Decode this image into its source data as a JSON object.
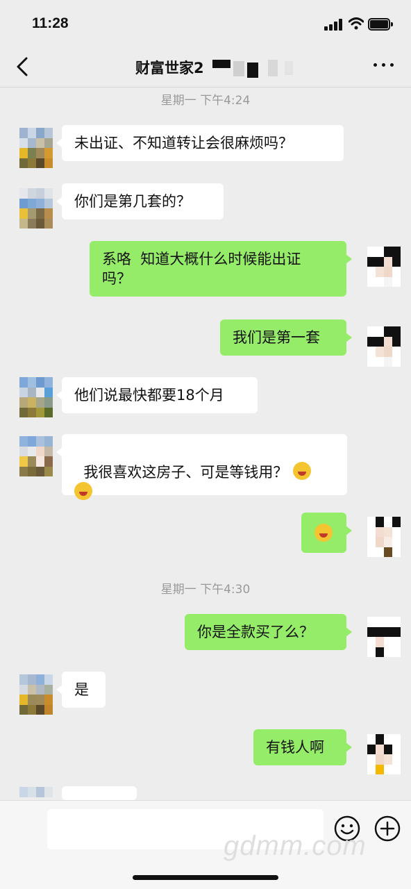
{
  "status": {
    "time": "11:28"
  },
  "header": {
    "title": "财富世家2"
  },
  "timestamps": [
    "星期一 下午4:24",
    "星期一 下午4:30"
  ],
  "messages": [
    {
      "from": "other",
      "text": "未出证、不知道转让会很麻烦吗？"
    },
    {
      "from": "other",
      "text": "你们是第几套的？"
    },
    {
      "from": "self",
      "text": "系咯  知道大概什么时候能出证\n吗？"
    },
    {
      "from": "self",
      "text": "我们是第一套"
    },
    {
      "from": "other",
      "text": "他们说最快都要18个月"
    },
    {
      "from": "other",
      "text": "我很喜欢这房子、可是等钱用？",
      "emoji": [
        "grinning-squinting-face",
        "grinning-squinting-face"
      ]
    },
    {
      "from": "self",
      "text": "",
      "emoji": [
        "crying-face"
      ]
    },
    {
      "from": "self",
      "text": "你是全款买了么？"
    },
    {
      "from": "other",
      "text": "是"
    },
    {
      "from": "self",
      "text": "有钱人啊"
    }
  ],
  "icons": {
    "back": "chevron-left-icon",
    "more": "more-dots-icon",
    "emoji": "smiley-icon",
    "plus": "plus-circle-icon"
  },
  "watermark": "gdmm.com",
  "colors": {
    "background": "#ededed",
    "self_bubble": "#95ec69",
    "other_bubble": "#ffffff",
    "timestamp": "#999999"
  }
}
